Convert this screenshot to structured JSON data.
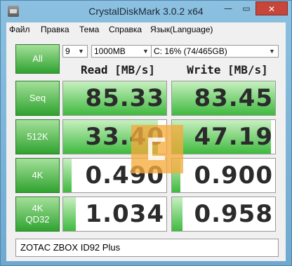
{
  "window": {
    "title": "CrystalDiskMark 3.0.2 x64",
    "min_glyph": "—",
    "max_glyph": "▭",
    "close_glyph": "✕"
  },
  "menu": {
    "items": [
      "Файл",
      "Правка",
      "Тема",
      "Справка",
      "Язык(Language)"
    ]
  },
  "controls": {
    "all_label": "All",
    "test_count": "9",
    "test_size": "1000MB",
    "drive": "C: 16% (74/465GB)",
    "dropdown_arrow": "▼"
  },
  "headers": {
    "read": "Read [MB/s]",
    "write": "Write [MB/s]"
  },
  "rows": [
    {
      "label": "Seq",
      "label2": "",
      "read": "85.33",
      "write": "83.45",
      "read_fill": 1.0,
      "write_fill": 1.0
    },
    {
      "label": "512K",
      "label2": "",
      "read": "33.40",
      "write": "47.19",
      "read_fill": 0.92,
      "write_fill": 0.96
    },
    {
      "label": "4K",
      "label2": "",
      "read": "0.490",
      "write": "0.900",
      "read_fill": 0.08,
      "write_fill": 0.08
    },
    {
      "label": "4K",
      "label2": "QD32",
      "read": "1.034",
      "write": "0.958",
      "read_fill": 0.12,
      "write_fill": 0.1
    }
  ],
  "comment": "ZOTAC ZBOX ID92 Plus",
  "colors": {
    "button_green": "#2fa32f",
    "bar_green": "#3fba3f",
    "close_red": "#c7453a",
    "watermark_orange": "#f5aa3c"
  }
}
